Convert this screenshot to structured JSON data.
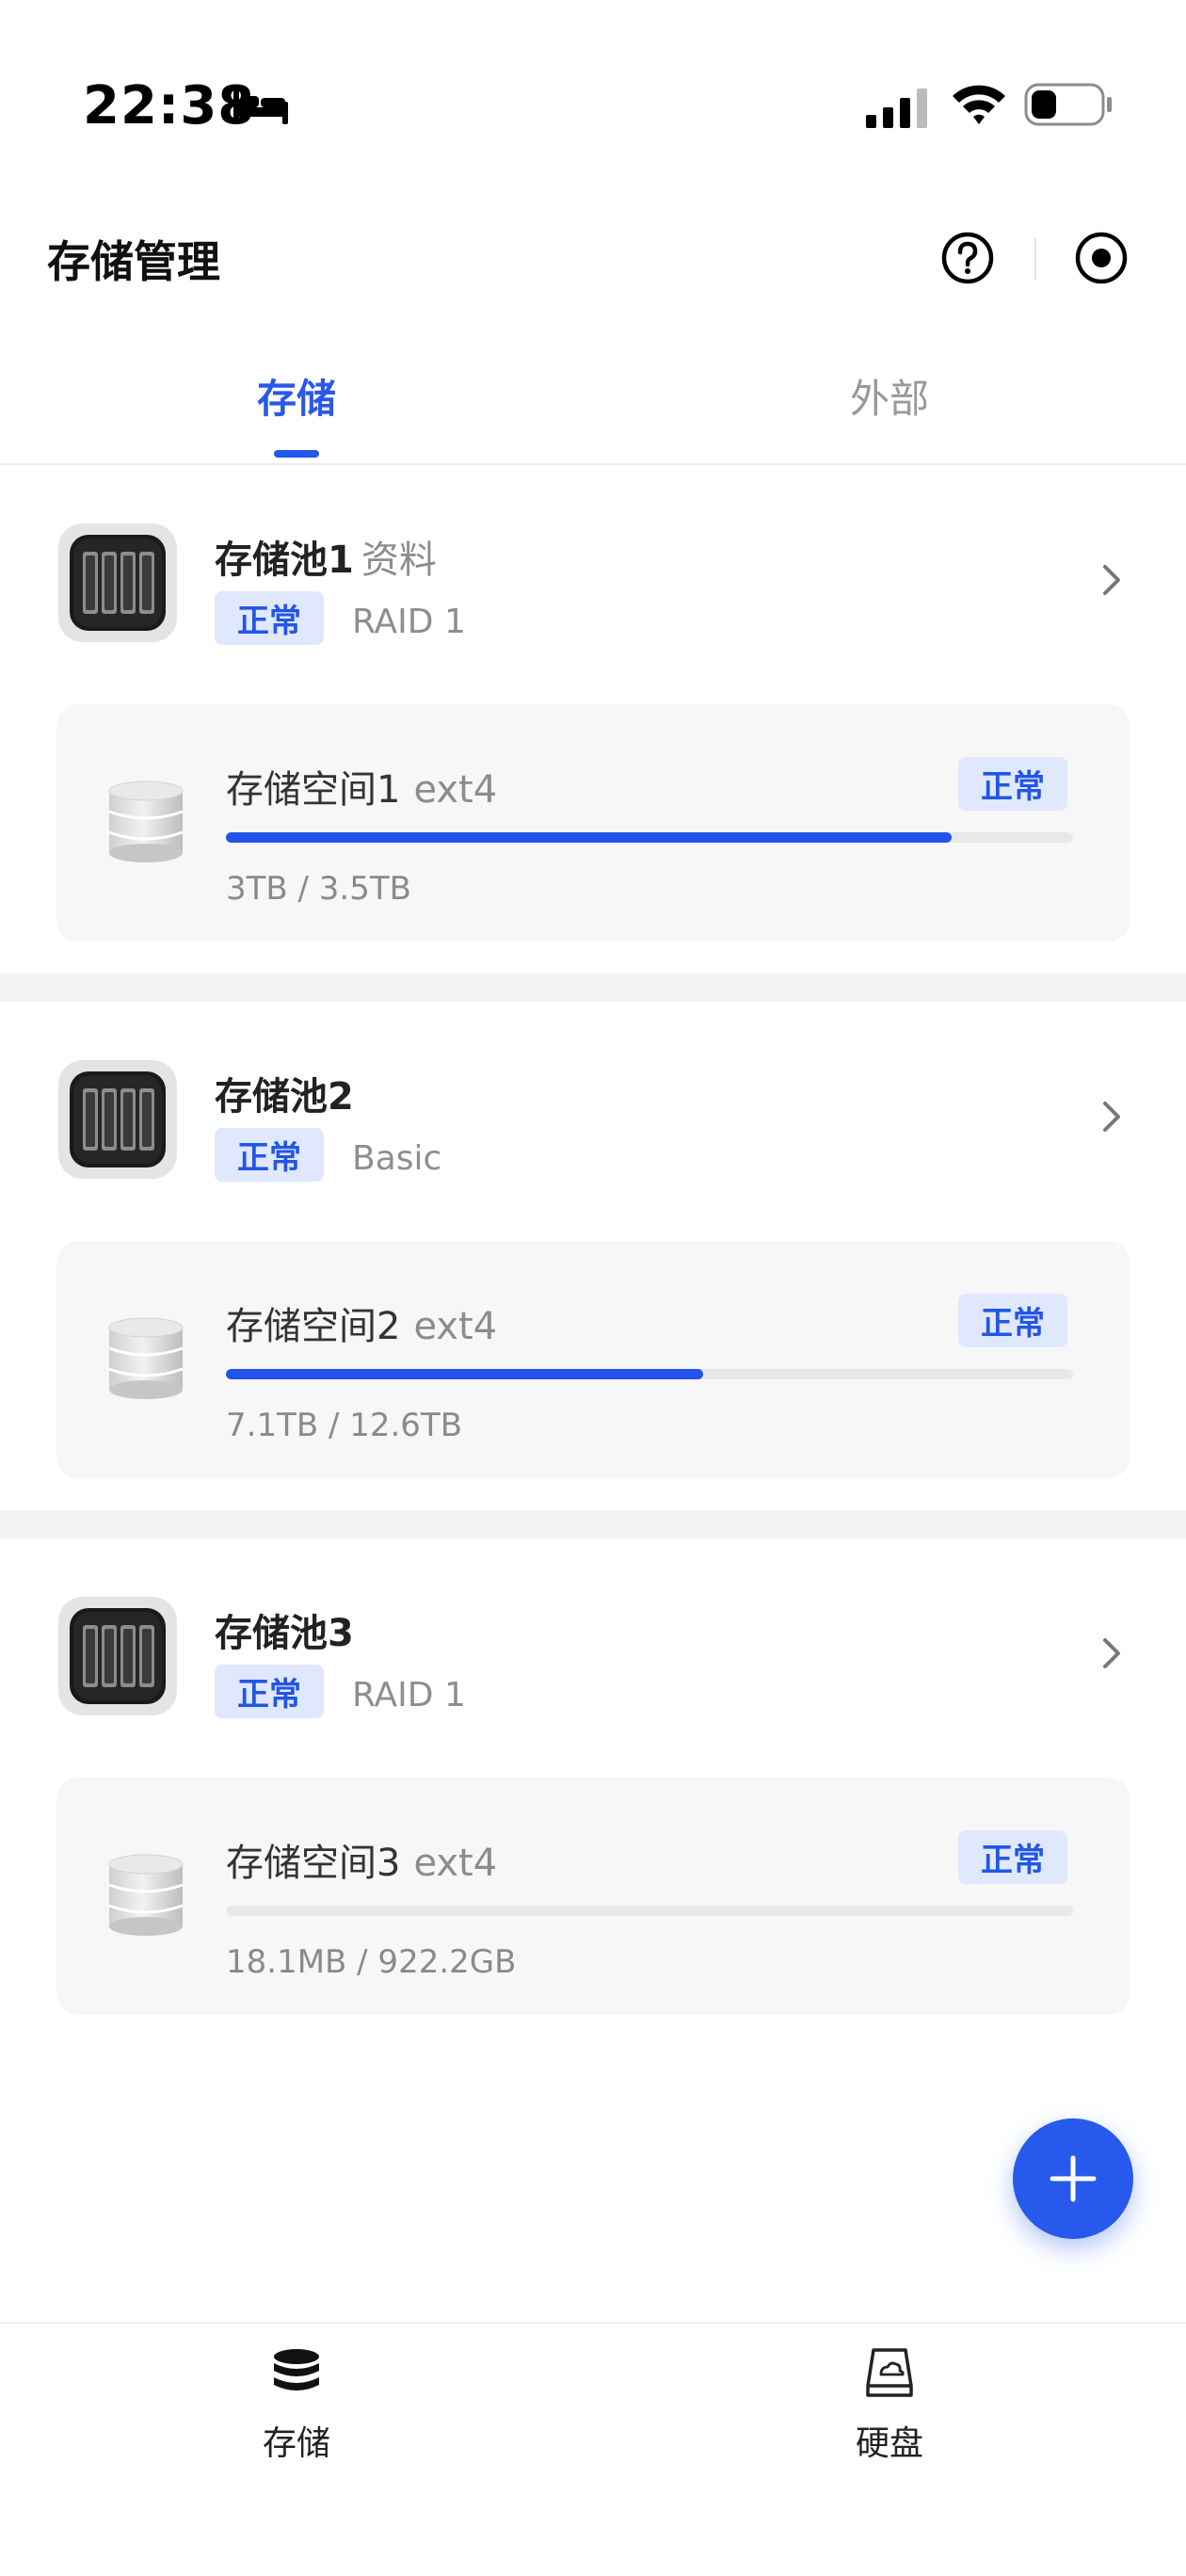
{
  "status_bar": {
    "time": "22:38",
    "icons": [
      "bed-icon",
      "signal-icon",
      "wifi-icon",
      "battery-icon"
    ]
  },
  "header": {
    "title": "存储管理",
    "help_icon": "question-circle-icon",
    "record_icon": "record-circle-icon"
  },
  "tabs": [
    {
      "label": "存储",
      "active": true
    },
    {
      "label": "外部",
      "active": false
    }
  ],
  "pools": [
    {
      "name": "存储池1",
      "description": "资料",
      "status": "正常",
      "raid": "RAID 1",
      "volume": {
        "name": "存储空间1",
        "fs": "ext4",
        "status": "正常",
        "used_fraction": 0.857,
        "usage": "3TB / 3.5TB"
      }
    },
    {
      "name": "存储池2",
      "description": "",
      "status": "正常",
      "raid": "Basic",
      "volume": {
        "name": "存储空间2",
        "fs": "ext4",
        "status": "正常",
        "used_fraction": 0.563,
        "usage": "7.1TB / 12.6TB"
      }
    },
    {
      "name": "存储池3",
      "description": "",
      "status": "正常",
      "raid": "RAID 1",
      "volume": {
        "name": "存储空间3",
        "fs": "ext4",
        "status": "正常",
        "used_fraction": 0.0,
        "usage": "18.1MB / 922.2GB"
      }
    }
  ],
  "fab": {
    "icon": "plus-icon"
  },
  "bottom_nav": [
    {
      "label": "存储",
      "icon": "database-icon",
      "active": true
    },
    {
      "label": "硬盘",
      "icon": "hard-disk-icon",
      "active": false
    }
  ],
  "colors": {
    "accent": "#2357ea",
    "badge_bg": "#dfe8fd",
    "card_bg": "#f7f7f7",
    "separator": "#f3f3f3"
  }
}
